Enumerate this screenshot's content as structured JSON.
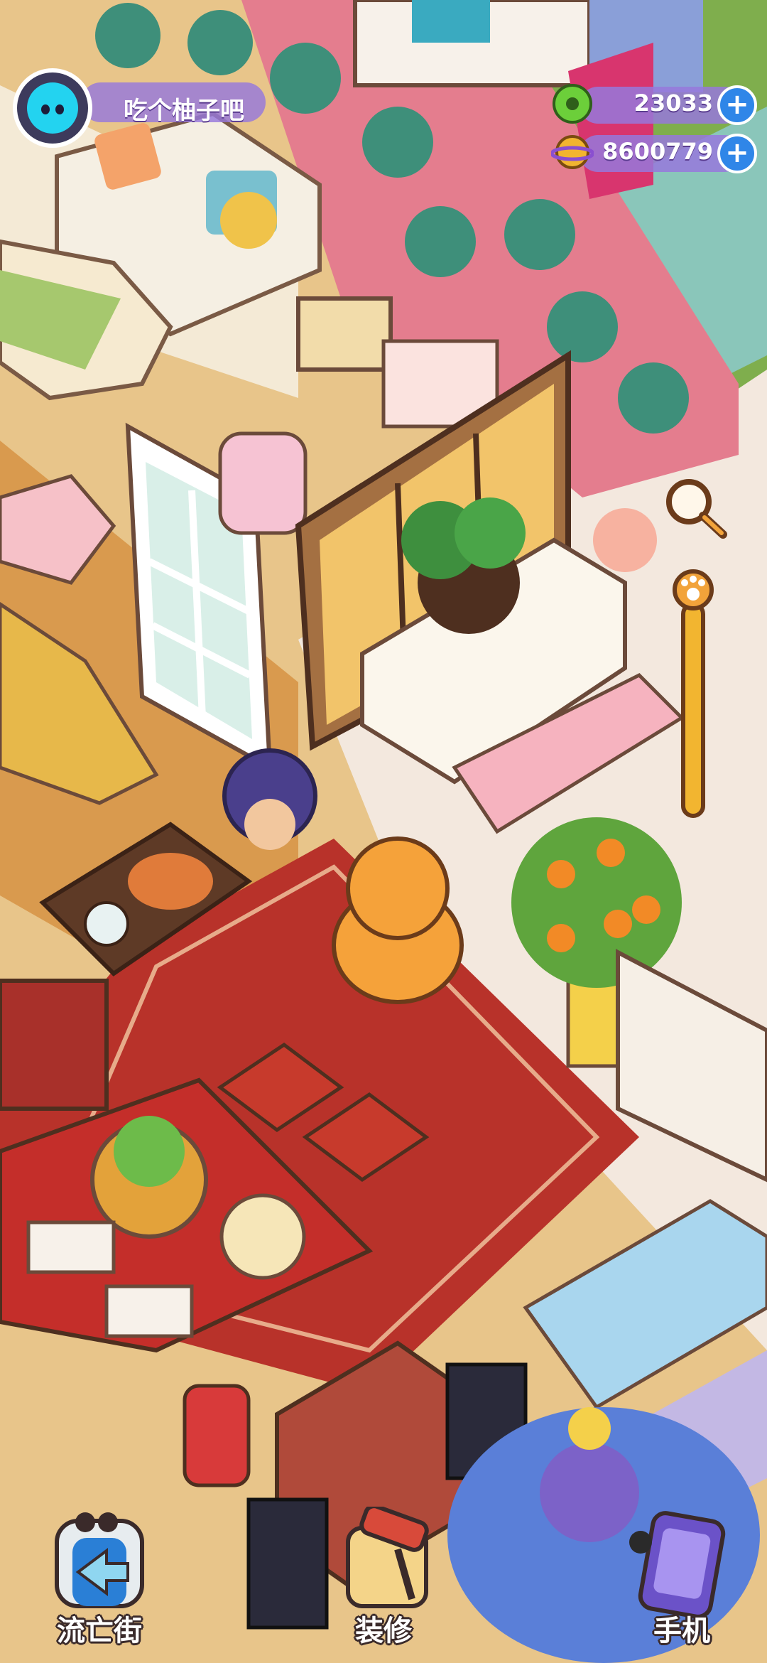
{
  "player": {
    "name": "吃个柚子吧",
    "avatar_icon": "cyan-cat-face-icon"
  },
  "currencies": [
    {
      "name": "donut",
      "icon": "donut-coin-icon",
      "value": "23033",
      "color": "#6ccf3a"
    },
    {
      "name": "planet",
      "icon": "planet-coin-icon",
      "value": "8600779",
      "color": "#f2b530"
    }
  ],
  "controls": {
    "search_icon": "magnifier-icon",
    "zoom_icon": "paw-zoom-slider-icon"
  },
  "nav": {
    "street": {
      "label": "流亡街",
      "icon": "portal-arrow-icon"
    },
    "decorate": {
      "label": "装修",
      "icon": "paint-roller-icon"
    },
    "phone": {
      "label": "手机",
      "icon": "phone-icon"
    }
  },
  "colors": {
    "accent": "#9678dc",
    "plus": "#2f86e8"
  }
}
